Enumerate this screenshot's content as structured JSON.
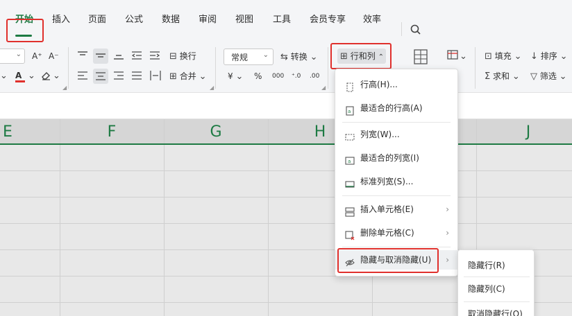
{
  "tabs": [
    "开始",
    "插入",
    "页面",
    "公式",
    "数据",
    "审阅",
    "视图",
    "工具",
    "会员专享",
    "效率"
  ],
  "ribbon": {
    "font_grow": "A⁺",
    "font_shrink": "A⁻",
    "font_color": "A",
    "wrap": "换行",
    "merge": "合并",
    "number_format": "常规",
    "convert": "转换",
    "currency": "¥",
    "percent": "%",
    "thousands": "000",
    "dec_inc": "⁺.0",
    "dec_dec": ".00",
    "rows_cols": "行和列",
    "fill": "填充",
    "sort": "排序",
    "sum": "求和",
    "filter": "筛选"
  },
  "columns": [
    "E",
    "F",
    "G",
    "H",
    "J"
  ],
  "dropdown": {
    "items": [
      "行高(H)...",
      "最适合的行高(A)",
      "列宽(W)...",
      "最适合的列宽(I)",
      "标准列宽(S)...",
      "插入单元格(E)",
      "删除单元格(C)",
      "隐藏与取消隐藏(U)"
    ]
  },
  "submenu": {
    "items": [
      "隐藏行(R)",
      "隐藏列(C)",
      "取消隐藏行(O)"
    ]
  },
  "colors": {
    "accent_green": "#1d7a43",
    "highlight_red": "#e0302c",
    "font_color_red": "#e0302c"
  }
}
